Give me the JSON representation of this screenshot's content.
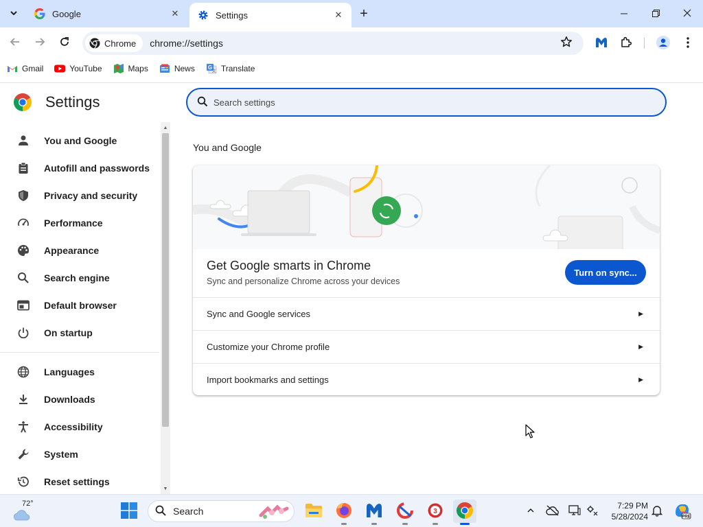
{
  "browser": {
    "tabs": [
      {
        "title": "Google",
        "active": false,
        "favicon": "google-g-icon"
      },
      {
        "title": "Settings",
        "active": true,
        "favicon": "gear-icon"
      }
    ],
    "omnibox": {
      "chip_label": "Chrome",
      "url": "chrome://settings"
    },
    "bookmarks": [
      {
        "label": "Gmail",
        "icon": "gmail-icon"
      },
      {
        "label": "YouTube",
        "icon": "youtube-icon"
      },
      {
        "label": "Maps",
        "icon": "maps-icon"
      },
      {
        "label": "News",
        "icon": "news-icon"
      },
      {
        "label": "Translate",
        "icon": "translate-icon"
      }
    ]
  },
  "settings": {
    "title": "Settings",
    "search_placeholder": "Search settings",
    "sidebar": [
      {
        "label": "You and Google",
        "icon": "person-icon"
      },
      {
        "label": "Autofill and passwords",
        "icon": "clipboard-icon"
      },
      {
        "label": "Privacy and security",
        "icon": "shield-icon"
      },
      {
        "label": "Performance",
        "icon": "speedometer-icon"
      },
      {
        "label": "Appearance",
        "icon": "palette-icon"
      },
      {
        "label": "Search engine",
        "icon": "search-icon"
      },
      {
        "label": "Default browser",
        "icon": "browser-window-icon"
      },
      {
        "label": "On startup",
        "icon": "power-icon"
      },
      {
        "label": "Languages",
        "icon": "globe-icon"
      },
      {
        "label": "Downloads",
        "icon": "download-icon"
      },
      {
        "label": "Accessibility",
        "icon": "accessibility-icon"
      },
      {
        "label": "System",
        "icon": "wrench-icon"
      },
      {
        "label": "Reset settings",
        "icon": "reset-icon"
      }
    ],
    "section_title": "You and Google",
    "promo": {
      "title": "Get Google smarts in Chrome",
      "subtitle": "Sync and personalize Chrome across your devices",
      "button": "Turn on sync..."
    },
    "rows": [
      {
        "label": "Sync and Google services"
      },
      {
        "label": "Customize your Chrome profile"
      },
      {
        "label": "Import bookmarks and settings"
      }
    ]
  },
  "taskbar": {
    "weather_temp": "72°",
    "search_label": "Search",
    "time": "7:29 PM",
    "date": "5/28/2024"
  },
  "colors": {
    "accent": "#0b57d0",
    "tabstrip": "#d3e3fd",
    "omnibox": "#edf2fa"
  }
}
